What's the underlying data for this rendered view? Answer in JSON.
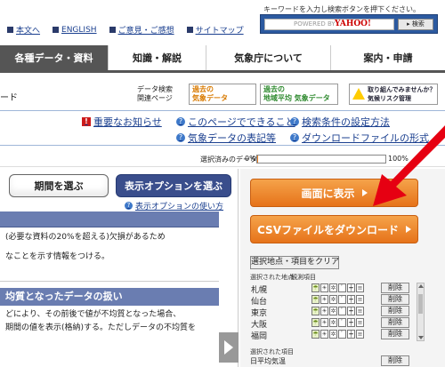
{
  "header": {
    "search_hint": "キーワードを入力し検索ボタンを押下ください。",
    "search_placeholder": "POWERED BY",
    "search_brand": "YAHOO!",
    "search_button": "検索",
    "links": [
      {
        "label": "本文へ"
      },
      {
        "label": "ENGLISH"
      },
      {
        "label": "ご意見・ご感想"
      },
      {
        "label": "サイトマップ"
      }
    ]
  },
  "nav": {
    "tabs": [
      {
        "label": "各種データ・資料",
        "active": true
      },
      {
        "label": "知識・解説",
        "active": false
      },
      {
        "label": "気象庁について",
        "active": false
      },
      {
        "label": "案内・申請",
        "active": false
      }
    ]
  },
  "related": {
    "fragment": "ード",
    "label_line1": "データ検索",
    "label_line2": "関連ページ",
    "banners": [
      {
        "line1": "過去の",
        "line2": "気象データ"
      },
      {
        "line1": "過去の",
        "line2": "地域平均 気象データ"
      },
      {
        "line1": "取り組んでみませんか？",
        "line2": "気候リスク管理"
      }
    ]
  },
  "help_links": {
    "important": "重要なお知らせ",
    "can_do": "このページでできること",
    "search_settings": "検索条件の設定方法",
    "notation": "気象データの表記等",
    "download_format": "ダウンロードファイルの形式"
  },
  "progress": {
    "label": "選択済みのデータ量",
    "min_label": "0%",
    "max_label": "100%",
    "value_percent": 1
  },
  "left": {
    "period_button": "期間を選ぶ",
    "options_button": "表示オプションを選ぶ",
    "options_help": "表示オプションの使い方",
    "para1_line1": "(必要な資料の20%を超える)欠損があるため",
    "para1_line2": "なことを示す情報をつける。",
    "section2_title": "均質となったデータの扱い",
    "para2_line1": "どにより、その前後で値が不均質となった場合、",
    "para2_line2": "期間の値を表示(格納)する。ただしデータの不均質を"
  },
  "right": {
    "display_button": "画面に表示",
    "csv_button": "CSVファイルをダウンロード",
    "clear_button": "選択地点・項目をクリア",
    "stations_header": "選択された地点",
    "items_header": "観測項目",
    "stations": [
      {
        "name": "札幌",
        "delete": "削除"
      },
      {
        "name": "仙台",
        "delete": "削除"
      },
      {
        "name": "東京",
        "delete": "削除"
      },
      {
        "name": "大阪",
        "delete": "削除"
      },
      {
        "name": "福岡",
        "delete": "削除"
      }
    ],
    "station_icons": [
      "☂",
      "☀",
      "✲",
      "ﾞ",
      "┿",
      "≡"
    ],
    "selected_items_header": "選択された項目",
    "selected_item": "日平均気温",
    "selected_item_delete": "削除"
  },
  "colors": {
    "accent_orange": "#e6731a",
    "annotation_red": "#e60012",
    "nav_active": "#555555",
    "options_button": "#3a4e8c"
  }
}
